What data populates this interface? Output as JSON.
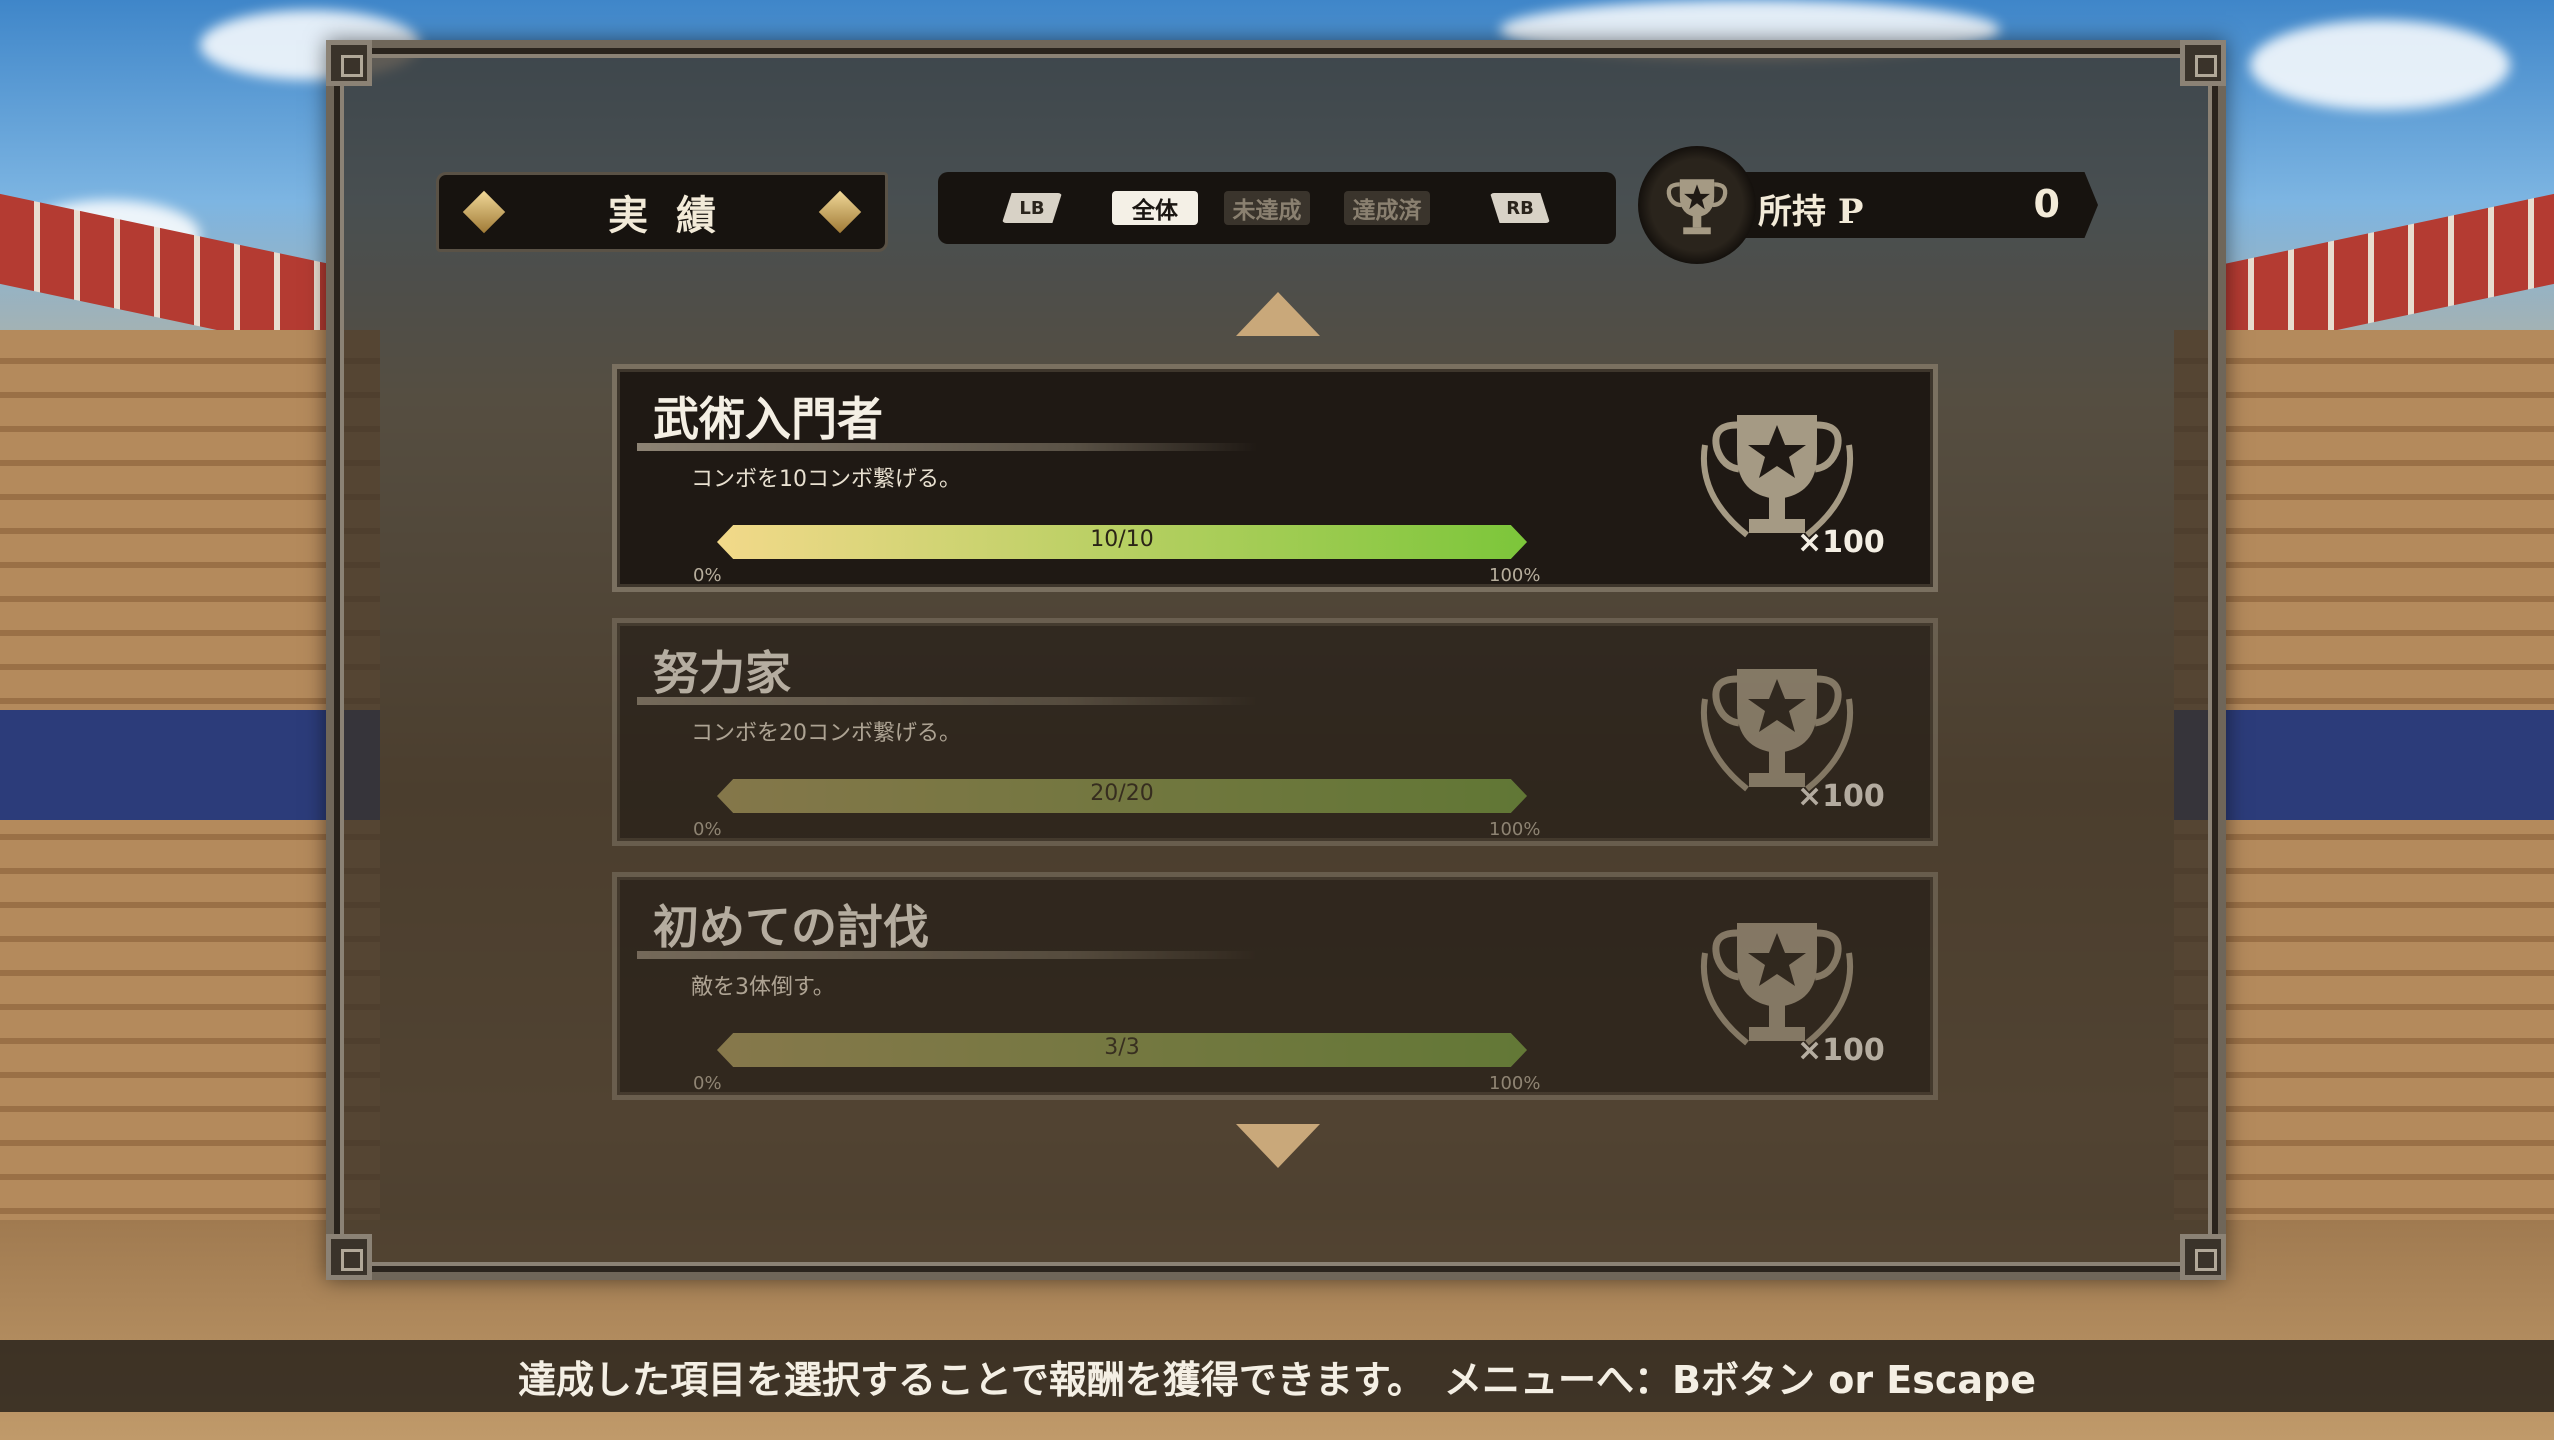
{
  "header": {
    "title": "実績",
    "tabs": [
      "LB",
      "全体",
      "未達成",
      "達成済",
      "RB"
    ],
    "active_tab": "全体",
    "points_label": "所持 P",
    "points_value": "0"
  },
  "achievements": [
    {
      "name": "武術入門者",
      "description": "コンボを10コンボ繋げる。",
      "progress_text": "10/10",
      "progress": 1.0,
      "min_label": "0%",
      "max_label": "100%",
      "reward": "×100",
      "emphasized": true
    },
    {
      "name": "努力家",
      "description": "コンボを20コンボ繋げる。",
      "progress_text": "20/20",
      "progress": 1.0,
      "min_label": "0%",
      "max_label": "100%",
      "reward": "×100",
      "emphasized": false
    },
    {
      "name": "初めての討伐",
      "description": "敵を3体倒す。",
      "progress_text": "3/3",
      "progress": 1.0,
      "min_label": "0%",
      "max_label": "100%",
      "reward": "×100",
      "emphasized": false
    }
  ],
  "footer": {
    "text": "達成した項目を選択することで報酬を獲得できます。　メニューへ：Bボタン or Escape"
  },
  "colors": {
    "bar_start": "#f2d98a",
    "bar_end": "#7cc63a",
    "bar_dim_start": "#a89a5c",
    "bar_dim_end": "#6f9a3a",
    "trophy": "#a59a84"
  },
  "icons": {
    "trophy": "trophy-laurel-icon",
    "scroll_up": "chevron-up-icon",
    "scroll_down": "chevron-down-icon"
  }
}
